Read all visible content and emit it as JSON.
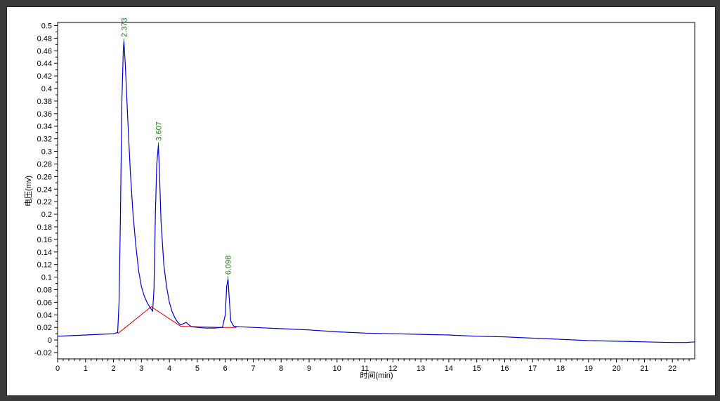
{
  "chart_data": {
    "type": "line",
    "xlabel": "时间(min)",
    "ylabel": "电压(mv)",
    "xlim": [
      0,
      22.8
    ],
    "ylim": [
      -0.03,
      0.505
    ],
    "x_ticks": [
      0,
      1,
      2,
      3,
      4,
      5,
      6,
      7,
      8,
      9,
      10,
      11,
      12,
      13,
      14,
      15,
      16,
      17,
      18,
      19,
      20,
      21,
      22
    ],
    "y_ticks": [
      -0.02,
      0,
      0.02,
      0.04,
      0.06,
      0.08,
      0.1,
      0.12,
      0.14,
      0.16,
      0.18,
      0.2,
      0.22,
      0.24,
      0.26,
      0.28,
      0.3,
      0.32,
      0.34,
      0.36,
      0.38,
      0.4,
      0.42,
      0.44,
      0.46,
      0.48,
      0.5
    ],
    "x_tick_labels": [
      "0",
      "1",
      "2",
      "3",
      "4",
      "5",
      "6",
      "7",
      "8",
      "9",
      "10",
      "11",
      "12",
      "13",
      "14",
      "15",
      "16",
      "17",
      "18",
      "19",
      "20",
      "21",
      "22"
    ],
    "y_tick_labels": [
      "-0.02",
      "0",
      "0.02",
      "0.04",
      "0.06",
      "0.08",
      "0.1",
      "0.12",
      "0.14",
      "0.16",
      "0.18",
      "0.2",
      "0.22",
      "0.24",
      "0.26",
      "0.28",
      "0.3",
      "0.32",
      "0.34",
      "0.36",
      "0.38",
      "0.4",
      "0.42",
      "0.44",
      "0.46",
      "0.48",
      "0.5"
    ],
    "grid": false,
    "line_color": "#0000cc",
    "baseline_color": "#dd0000",
    "label_color": "#1a7a1a",
    "series": [
      {
        "values_x": [
          0,
          0.5,
          1,
          1.5,
          2,
          2.15,
          2.2,
          2.25,
          2.3,
          2.35,
          2.373,
          2.42,
          2.5,
          2.6,
          2.7,
          2.8,
          2.9,
          3.0,
          3.1,
          3.2,
          3.3,
          3.4,
          3.45,
          3.5,
          3.55,
          3.607,
          3.65,
          3.7,
          3.8,
          3.9,
          4.0,
          4.1,
          4.2,
          4.3,
          4.4,
          4.5,
          4.6,
          4.7,
          4.8,
          5.0,
          5.3,
          5.6,
          5.9,
          6.0,
          6.05,
          6.098,
          6.15,
          6.2,
          6.3,
          6.5,
          7,
          8,
          9,
          10,
          11,
          12,
          13,
          14,
          15,
          16,
          17,
          18,
          19,
          20,
          21,
          22,
          22.5,
          22.8
        ],
        "values_y": [
          0.006,
          0.007,
          0.008,
          0.009,
          0.01,
          0.012,
          0.06,
          0.2,
          0.38,
          0.46,
          0.475,
          0.44,
          0.36,
          0.27,
          0.2,
          0.15,
          0.11,
          0.085,
          0.07,
          0.06,
          0.052,
          0.046,
          0.08,
          0.2,
          0.28,
          0.31,
          0.26,
          0.19,
          0.12,
          0.085,
          0.06,
          0.045,
          0.035,
          0.028,
          0.024,
          0.026,
          0.028,
          0.024,
          0.021,
          0.02,
          0.019,
          0.019,
          0.02,
          0.04,
          0.085,
          0.097,
          0.06,
          0.03,
          0.022,
          0.021,
          0.02,
          0.018,
          0.016,
          0.013,
          0.011,
          0.01,
          0.009,
          0.008,
          0.006,
          0.005,
          0.003,
          0.001,
          -0.001,
          -0.002,
          -0.003,
          -0.004,
          -0.004,
          -0.003
        ]
      }
    ],
    "baselines": [
      {
        "x": [
          2.15,
          3.35,
          4.4,
          5.9,
          6.4
        ],
        "y": [
          0.01,
          0.053,
          0.022,
          0.02,
          0.02
        ]
      }
    ],
    "peaks": [
      {
        "x": 2.373,
        "y": 0.475,
        "label": "2.373"
      },
      {
        "x": 3.607,
        "y": 0.31,
        "label": "3.607"
      },
      {
        "x": 6.098,
        "y": 0.097,
        "label": "6.098"
      }
    ]
  }
}
